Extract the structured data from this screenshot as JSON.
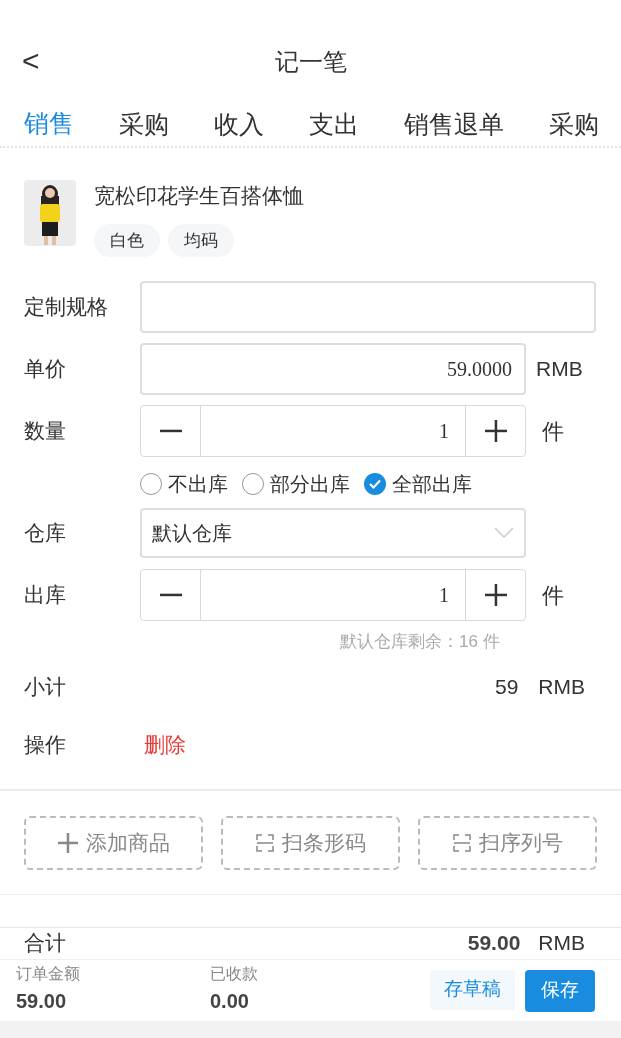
{
  "header": {
    "back": "<",
    "title": "记一笔"
  },
  "tabs": [
    {
      "label": "销售",
      "selected": true
    },
    {
      "label": "采购",
      "selected": false
    },
    {
      "label": "收入",
      "selected": false
    },
    {
      "label": "支出",
      "selected": false
    },
    {
      "label": "销售退单",
      "selected": false
    },
    {
      "label": "采购",
      "selected": false
    }
  ],
  "product": {
    "name": "宽松印花学生百搭体恤",
    "tags": [
      "白色",
      "均码"
    ]
  },
  "custom_spec": {
    "label": "定制规格"
  },
  "unit_price": {
    "label": "单价",
    "value": "59.0000",
    "unit": "RMB"
  },
  "quantity": {
    "label": "数量",
    "value": "1",
    "unit": "件"
  },
  "stock_options": [
    {
      "label": "不出库",
      "selected": false
    },
    {
      "label": "部分出库",
      "selected": false
    },
    {
      "label": "全部出库",
      "selected": true
    }
  ],
  "warehouse": {
    "label": "仓库",
    "value": "默认仓库"
  },
  "outbound": {
    "label": "出库",
    "value": "1",
    "unit": "件",
    "remaining": "默认仓库剩余：16 件"
  },
  "subtotal": {
    "label": "小计",
    "value": "59",
    "unit": "RMB"
  },
  "action": {
    "label": "操作",
    "delete": "删除"
  },
  "add_buttons": [
    {
      "kind": "add",
      "label": "添加商品"
    },
    {
      "kind": "scan",
      "label": "扫条形码"
    },
    {
      "kind": "scan",
      "label": "扫序列号"
    }
  ],
  "total": {
    "label": "合计",
    "value": "59.00",
    "unit": "RMB"
  },
  "footer": {
    "order_label": "订单金额",
    "order_value": "59.00",
    "received_label": "已收款",
    "received_value": "0.00",
    "draft": "存草稿",
    "save": "保存"
  }
}
